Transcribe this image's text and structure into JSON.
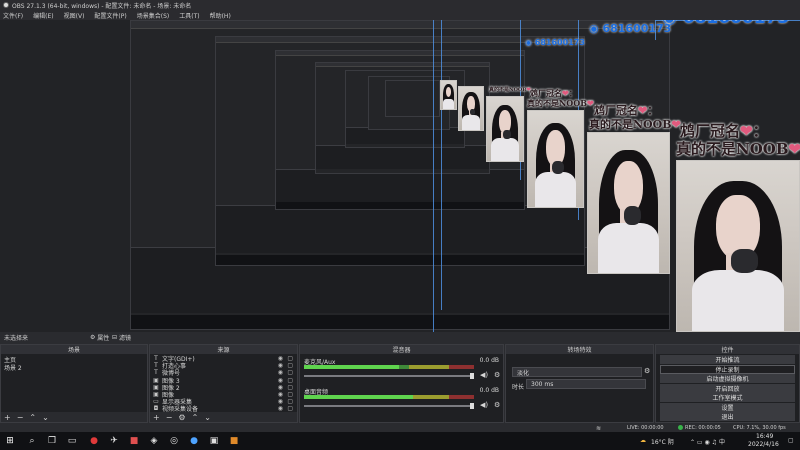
{
  "window": {
    "title": "OBS 27.1.3 (64-bit, windows) - 配置文件: 未命名 - 场景: 未命名"
  },
  "menu": [
    "文件(F)",
    "编辑(E)",
    "视图(V)",
    "配置文件(P)",
    "场景集合(S)",
    "工具(T)",
    "帮助(H)"
  ],
  "overlay": {
    "id_text": "681600173",
    "caption_line1": "鸩厂冠名",
    "caption_line2": "真的不是NOOB",
    "heart": "❤",
    "colon": "："
  },
  "dock": {
    "tabs": {
      "scene_transitions": "未选择来",
      "filters": "属性",
      "filters2": "滤镜"
    },
    "scenes": {
      "title": "场景",
      "items": [
        {
          "name": "主页",
          "selected": false
        },
        {
          "name": "场景 2",
          "selected": false
        }
      ]
    },
    "sources": {
      "title": "来源",
      "items": [
        {
          "name": "文字(GDI+)",
          "icon": "text-icon"
        },
        {
          "name": "打造心事",
          "icon": "text-icon"
        },
        {
          "name": "微博号",
          "icon": "text-icon"
        },
        {
          "name": "图像 3",
          "icon": "image-icon"
        },
        {
          "name": "图像 2",
          "icon": "image-icon"
        },
        {
          "name": "图像",
          "icon": "image-icon"
        },
        {
          "name": "显示器采集",
          "icon": "monitor-icon"
        },
        {
          "name": "视频采集设备",
          "icon": "camera-icon"
        }
      ]
    },
    "mixer": {
      "title": "混音器",
      "channels": [
        {
          "name": "麦克风/Aux",
          "db": "0.0 dB",
          "level": 0.56
        },
        {
          "name": "桌面音频",
          "db": "0.0 dB",
          "level": 0.64
        }
      ]
    },
    "transitions": {
      "title": "转场特效",
      "selected": "淡化",
      "duration_label": "时长",
      "duration_value": "300 ms"
    },
    "controls": {
      "title": "控件",
      "buttons": [
        {
          "label": "开始推流",
          "active": false
        },
        {
          "label": "停止录制",
          "active": true
        },
        {
          "label": "启动虚拟摄像机",
          "active": false
        },
        {
          "label": "开启回放",
          "active": false
        },
        {
          "label": "工作室模式",
          "active": false
        },
        {
          "label": "设置",
          "active": false
        },
        {
          "label": "退出",
          "active": false
        }
      ]
    }
  },
  "statusbar": {
    "live": "LIVE: 00:00:00",
    "rec": "REC: 00:00:05",
    "cpu": "CPU: 7.1%, 30.00 fps"
  },
  "taskbar": {
    "weather": "16°C 阴",
    "time": "16:49",
    "date": "2022/4/16"
  }
}
